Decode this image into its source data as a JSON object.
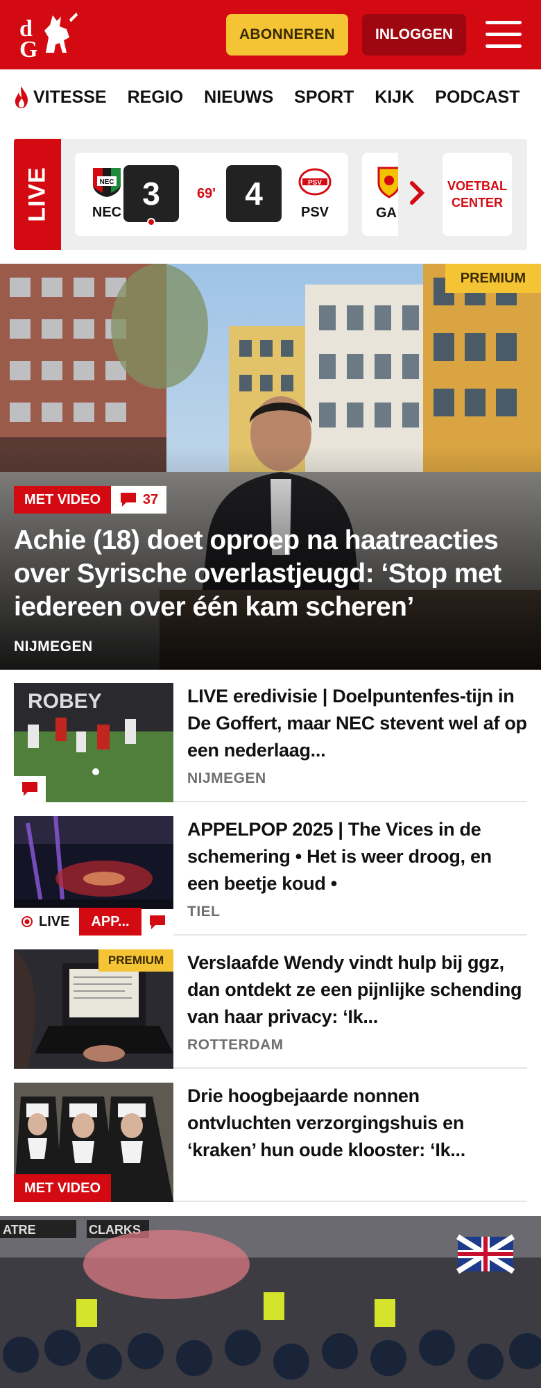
{
  "header": {
    "logo_text": "dG",
    "subscribe_label": "ABONNEREN",
    "login_label": "INLOGGEN",
    "brand_color": "#d30a11"
  },
  "nav": {
    "items": [
      "VITESSE",
      "REGIO",
      "NIEUWS",
      "SPORT",
      "KIJK",
      "PODCAST"
    ]
  },
  "live": {
    "tag": "LIVE",
    "match": {
      "home": "NEC",
      "home_score": "3",
      "minute": "69'",
      "away_score": "4",
      "away": "PSV"
    },
    "next_match_home": "GA",
    "voetbal_center_label": "VOETBAL CENTER"
  },
  "hero": {
    "badge_premium": "PREMIUM",
    "badge_video": "MET VIDEO",
    "comment_count": "37",
    "title": "Achie (18) doet oproep na haatreacties over Syrische overlastjeugd: ‘Stop met iedereen over één kam scheren’",
    "location": "NIJMEGEN"
  },
  "articles": [
    {
      "title": "LIVE eredivisie | Doelpuntenfes-tijn in De Goffert, maar NEC stevent wel af op een nederlaag...",
      "location": "NIJMEGEN"
    },
    {
      "title": "APPELPOP 2025 | The Vices in de schemering • Het is weer droog, en een beetje koud •",
      "location": "TIEL",
      "live_label": "LIVE",
      "tag_label": "APP..."
    },
    {
      "title": "Verslaafde Wendy vindt hulp bij ggz, dan ontdekt ze een pijnlijke schending van haar privacy: ‘Ik...",
      "location": "ROTTERDAM",
      "badge_premium": "PREMIUM"
    },
    {
      "title": "Drie hoogbejaarde nonnen ontvluchten verzorgingshuis en ‘kraken’ hun oude klooster: ‘Ik...",
      "badge_video": "MET VIDEO"
    }
  ],
  "bottom_image": {
    "sign_left": "ATRE",
    "sign_right": "CLARKS"
  }
}
